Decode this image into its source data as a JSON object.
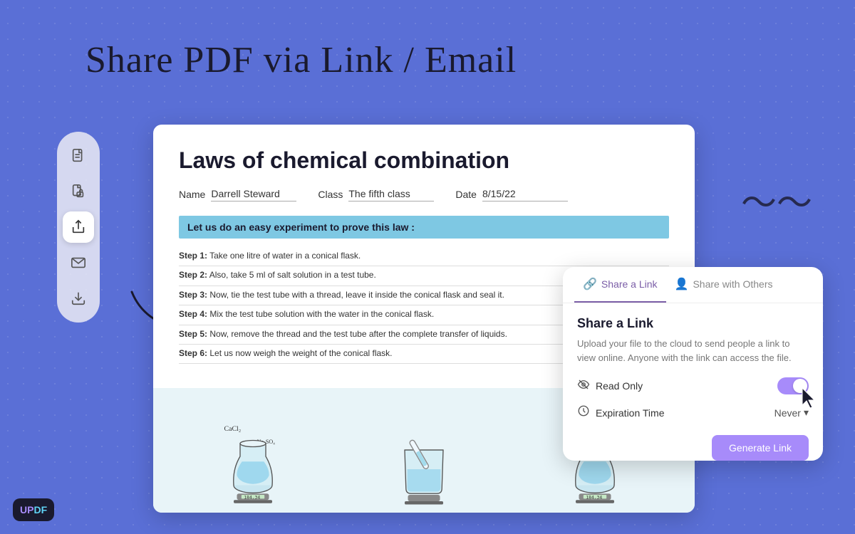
{
  "header": {
    "title": "Share PDF via Link / Email"
  },
  "updf": {
    "logo": "UPDF"
  },
  "sidebar": {
    "items": [
      {
        "id": "document-icon",
        "label": "Document"
      },
      {
        "id": "lock-document-icon",
        "label": "Lock Document"
      },
      {
        "id": "share-icon",
        "label": "Share"
      },
      {
        "id": "email-icon",
        "label": "Email"
      },
      {
        "id": "save-icon",
        "label": "Save"
      }
    ]
  },
  "pdf": {
    "title": "Laws of chemical combination",
    "fields": {
      "name_label": "Name",
      "name_value": "Darrell Steward",
      "class_label": "Class",
      "class_value": "The fifth class",
      "date_label": "Date",
      "date_value": "8/15/22"
    },
    "highlight": "Let us do an easy experiment to prove this law :",
    "steps": [
      {
        "label": "Step 1:",
        "text": "Take one litre of water in a conical flask."
      },
      {
        "label": "Step 2:",
        "text": "Also, take 5 ml of salt solution in a test tube."
      },
      {
        "label": "Step 3:",
        "text": "Now, tie the test tube with a thread, leave it inside the conical flask and seal it."
      },
      {
        "label": "Step 4:",
        "text": "Mix the test tube solution with the water in the conical flask."
      },
      {
        "label": "Step 5:",
        "text": "Now, remove the thread and the test tube after the complete transfer of liquids."
      },
      {
        "label": "Step 6:",
        "text": "Let us now weigh the weight of the conical flask."
      }
    ]
  },
  "share_panel": {
    "tab1_label": "Share a Link",
    "tab2_label": "Share with Others",
    "heading": "Share a Link",
    "description": "Upload your file to the cloud to send people a link to view online. Anyone with the link can access the file.",
    "option1_label": "Read Only",
    "option2_label": "Expiration Time",
    "expiry_value": "Never",
    "generate_btn": "Generate Link"
  }
}
